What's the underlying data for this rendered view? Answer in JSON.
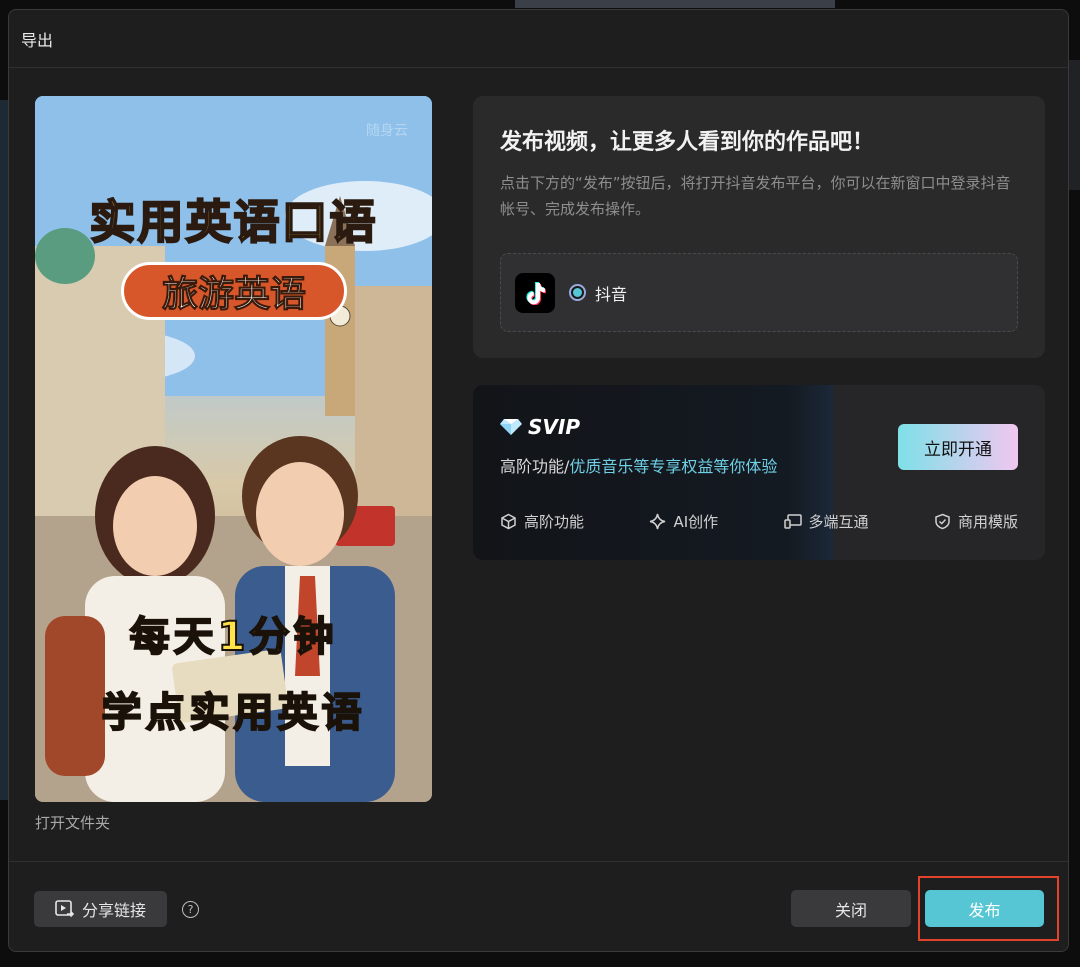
{
  "dialog": {
    "title": "导出"
  },
  "cover": {
    "logo_text": "随身云",
    "title_main": "实用英语口语",
    "title_pill": "旅游英语",
    "line1": "每天1分钟",
    "line2": "学点实用英语"
  },
  "open_folder": "打开文件夹",
  "publish_card": {
    "heading": "发布视频，让更多人看到你的作品吧！",
    "description": "点击下方的“发布”按钮后，将打开抖音发布平台，你可以在新窗口中登录抖音帐号、完成发布操作。",
    "platform": {
      "label": "抖音",
      "icon": "tiktok-icon",
      "selected": true
    }
  },
  "svip_card": {
    "badge": "SVIP",
    "desc_prefix": "高阶功能/",
    "desc_highlight": "优质音乐等专享权益等你体验",
    "cta": "立即开通",
    "features": [
      {
        "label": "高阶功能",
        "icon": "cube-icon"
      },
      {
        "label": "AI创作",
        "icon": "sparkle-icon"
      },
      {
        "label": "多端互通",
        "icon": "devices-icon"
      },
      {
        "label": "商用模版",
        "icon": "shield-check-icon"
      }
    ],
    "accent": "#56c6d4"
  },
  "footer": {
    "share_label": "分享链接",
    "help": "?",
    "close_label": "关闭",
    "publish_label": "发布"
  }
}
